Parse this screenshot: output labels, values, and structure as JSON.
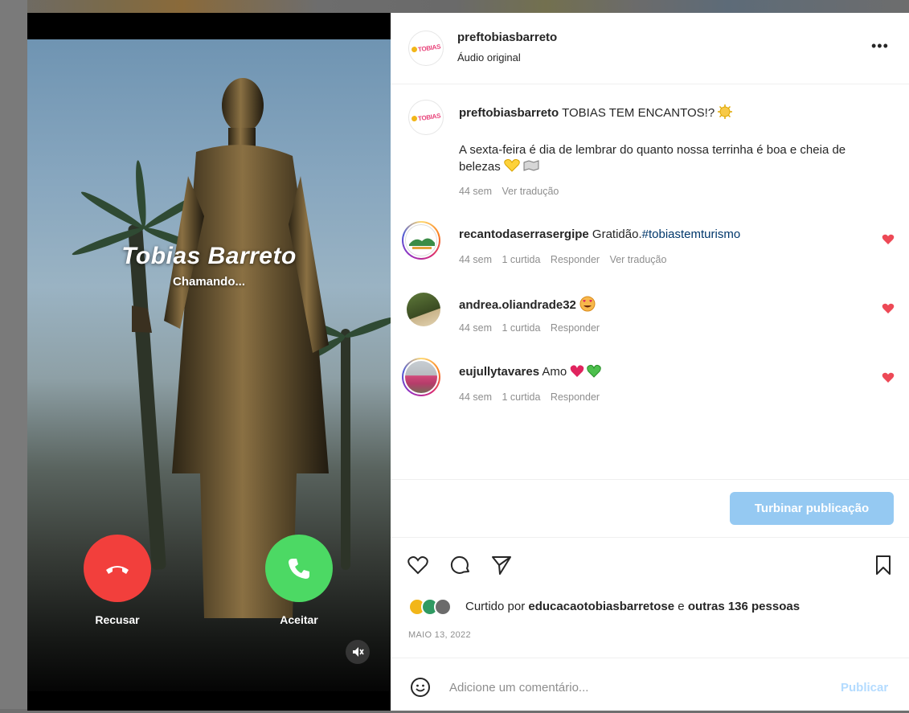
{
  "video": {
    "caller_name": "Tobias Barreto",
    "call_status": "Chamando...",
    "decline_label": "Recusar",
    "accept_label": "Aceitar",
    "mute_icon": "speaker-muted-icon"
  },
  "post_header": {
    "username": "preftobiasbarreto",
    "audio": "Áudio original",
    "more_icon": "more-options-icon"
  },
  "caption": {
    "username": "preftobiasbarreto",
    "title_text": "TOBIAS TEM ENCANTOS!?",
    "body": "A sexta-feira é dia de lembrar do quanto nossa terrinha é boa e cheia de belezas",
    "time": "44 sem",
    "translate": "Ver tradução"
  },
  "comments": [
    {
      "username": "recantodaserrasergipe",
      "text": "Gratidão.",
      "hashtag": "#tobiastemturismo",
      "time": "44 sem",
      "likes": "1 curtida",
      "reply": "Responder",
      "translate": "Ver tradução"
    },
    {
      "username": "andrea.oliandrade32",
      "text": "",
      "time": "44 sem",
      "likes": "1 curtida",
      "reply": "Responder"
    },
    {
      "username": "eujullytavares",
      "text": "Amo",
      "time": "44 sem",
      "likes": "1 curtida",
      "reply": "Responder"
    }
  ],
  "boost_button": "Turbinar publicação",
  "actions": {
    "like_icon": "heart-outline-icon",
    "comment_icon": "comment-icon",
    "share_icon": "send-icon",
    "save_icon": "bookmark-icon"
  },
  "likes": {
    "prefix": "Curtido por",
    "user": "educacaotobiasbarretose",
    "conjunction": "e",
    "others": "outras 136 pessoas"
  },
  "post_date": "MAIO 13, 2022",
  "comment_box": {
    "placeholder": "Adicione um comentário...",
    "publish": "Publicar",
    "emoji_icon": "emoji-icon"
  },
  "colors": {
    "decline": "#f23f3c",
    "accept": "#4cd964",
    "like_red": "#ed4956",
    "link": "#00376b",
    "boost": "#95c9f2"
  }
}
